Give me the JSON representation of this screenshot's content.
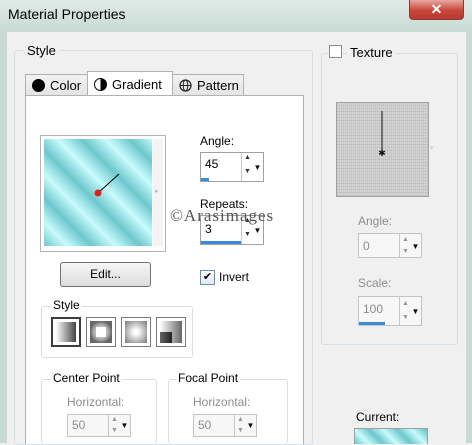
{
  "window": {
    "title": "Material Properties",
    "close_glyph": "✕"
  },
  "style_group": {
    "label": "Style"
  },
  "tabs": [
    {
      "label": "Color",
      "icon": "black-circle-icon"
    },
    {
      "label": "Gradient",
      "icon": "gradient-circle-icon",
      "active": true
    },
    {
      "label": "Pattern",
      "icon": "globe-icon"
    }
  ],
  "gradient": {
    "angle_label": "Angle:",
    "angle_value": "45",
    "repeats_label": "Repeats:",
    "repeats_value": "3",
    "edit_button": "Edit...",
    "invert_label": "Invert",
    "invert_checked": true,
    "style_label": "Style",
    "style_options": [
      "linear-gradient-icon",
      "rectangular-gradient-icon",
      "sunburst-gradient-icon",
      "radial-gradient-icon"
    ],
    "center_point_label": "Center Point",
    "focal_point_label": "Focal Point",
    "center_horizontal_label": "Horizontal:",
    "center_horizontal_value": "50",
    "focal_horizontal_label": "Horizontal:",
    "focal_horizontal_value": "50",
    "watermark": "©Arasimages"
  },
  "texture": {
    "label": "Texture",
    "checked": false,
    "angle_label": "Angle:",
    "angle_value": "0",
    "scale_label": "Scale:",
    "scale_value": "100"
  },
  "current": {
    "label": "Current:"
  },
  "colors": {
    "accent": "#3c8ad9",
    "gradient_a": "#6cc7cd",
    "gradient_b": "#c8fbfd",
    "close_red": "#c9453a"
  }
}
